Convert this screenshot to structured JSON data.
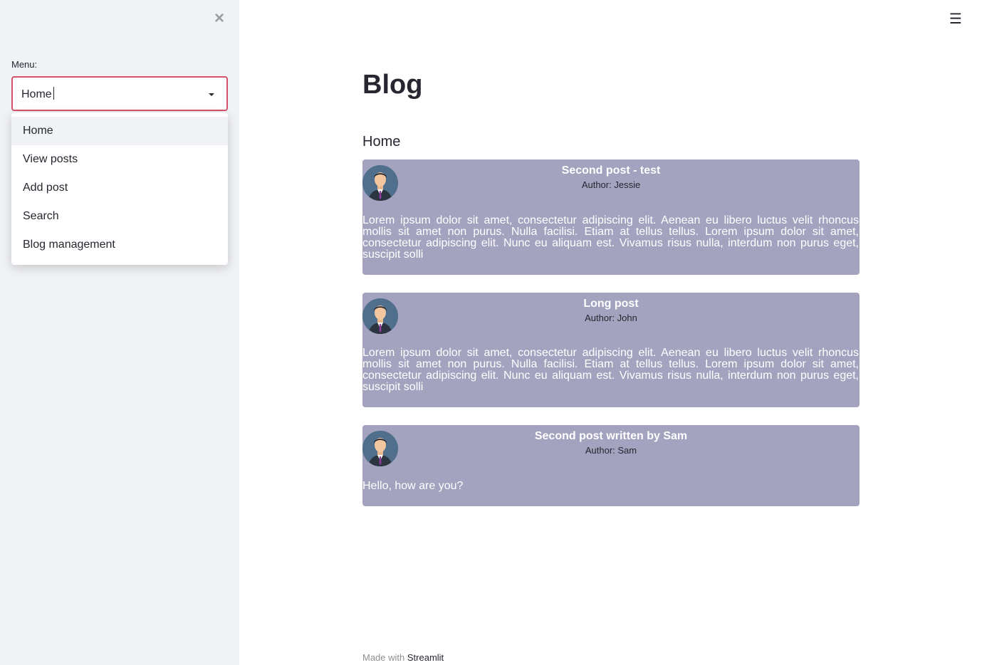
{
  "sidebar": {
    "close_icon": "close-icon",
    "menu_label": "Menu:",
    "select_value": "Home",
    "options": [
      "Home",
      "View posts",
      "Add post",
      "Search",
      "Blog management"
    ]
  },
  "header": {
    "menu_icon": "hamburger-icon"
  },
  "main": {
    "title": "Blog",
    "section": "Home",
    "posts": [
      {
        "title": "Second post - test",
        "author": "Author: Jessie",
        "body": "Lorem ipsum dolor sit amet, consectetur adipiscing elit. Aenean eu libero luctus velit rhoncus mollis sit amet non purus. Nulla facilisi. Etiam at tellus tellus. Lorem ipsum dolor sit amet, consectetur adipiscing elit. Nunc eu aliquam est. Vivamus risus nulla, interdum non purus eget, suscipit solli"
      },
      {
        "title": "Long post",
        "author": "Author: John",
        "body": "Lorem ipsum dolor sit amet, consectetur adipiscing elit. Aenean eu libero luctus velit rhoncus mollis sit amet non purus. Nulla facilisi. Etiam at tellus tellus. Lorem ipsum dolor sit amet, consectetur adipiscing elit. Nunc eu aliquam est. Vivamus risus nulla, interdum non purus eget, suscipit solli"
      },
      {
        "title": "Second post written by Sam",
        "author": "Author: Sam",
        "body": "Hello, how are you?"
      }
    ]
  },
  "footer": {
    "prefix": "Made with",
    "link": "Streamlit"
  },
  "colors": {
    "accent": "#d4506b",
    "post_bg": "#a3a2bf",
    "sidebar_bg": "#f0f2f6"
  }
}
